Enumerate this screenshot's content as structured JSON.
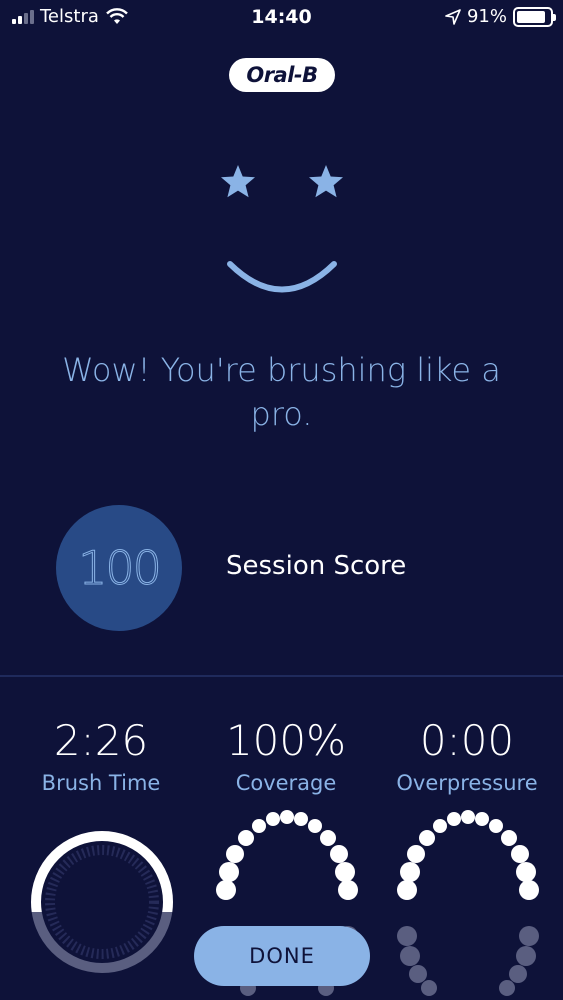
{
  "status_bar": {
    "carrier": "Telstra",
    "time": "14:40",
    "battery": "91%",
    "icons": [
      "signal-icon",
      "wifi-icon",
      "location-arrow-icon",
      "battery-icon"
    ]
  },
  "brand": {
    "logo_text": "Oral-B"
  },
  "feedback": {
    "headline": "Wow! You're brushing like a pro."
  },
  "score": {
    "value": "100",
    "label": "Session Score"
  },
  "stats": [
    {
      "value": "2:26",
      "label": "Brush Time"
    },
    {
      "value": "100%",
      "label": "Coverage"
    },
    {
      "value": "0:00",
      "label": "Overpressure"
    }
  ],
  "actions": {
    "done_label": "DONE"
  },
  "colors": {
    "background": "#0e1239",
    "accent": "#8ab3e6",
    "score_circle": "#284a86",
    "teeth_active": "#ffffff",
    "teeth_inactive": "#5a5e80"
  }
}
